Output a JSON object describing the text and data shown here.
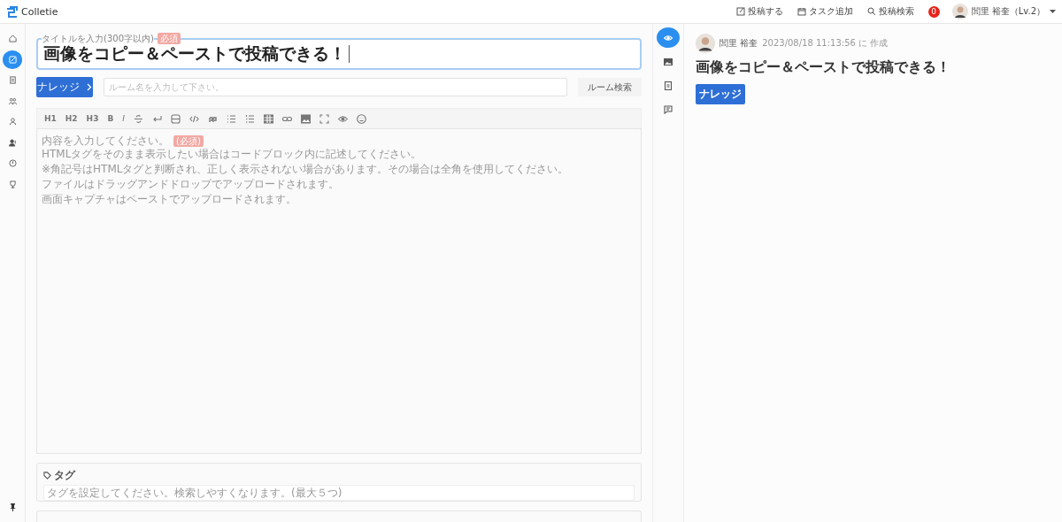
{
  "header": {
    "logo": "Colletie",
    "actions": [
      "投稿する",
      "タスク追加",
      "投稿検索"
    ],
    "notification_count": "0",
    "user_name": "閭里 裕奎（Lv.2）"
  },
  "sidebar": {
    "items": [
      {
        "selected": false
      },
      {
        "selected": true
      },
      {
        "selected": false
      },
      {
        "selected": false
      },
      {
        "selected": false
      },
      {
        "selected": false
      },
      {
        "selected": false
      },
      {
        "selected": false
      }
    ]
  },
  "editor": {
    "title_label": "タイトルを入力(300字以内)",
    "title_required": "必須",
    "title_value": "画像をコピー＆ペーストで投稿できる！",
    "category_button": "ナレッジ",
    "room_placeholder": "ルーム名を入力して下さい。",
    "room_search_button": "ルーム検索",
    "toolbar_text_buttons": [
      "H1",
      "H2",
      "H3",
      "B",
      "I"
    ],
    "content_placeholder": "内容を入力してください。",
    "content_required": "(必須)",
    "content_hints": [
      "HTMLタグをそのまま表示したい場合はコードブロック内に記述してください。",
      "※角記号はHTMLタグと判断され、正しく表示されない場合があります。その場合は全角を使用してください。",
      "ファイルはドラッグアンドドロップでアップロードされます。",
      "画面キャプチャはペーストでアップロードされます。"
    ],
    "tag_title": "タグ",
    "tag_placeholder": "タグを設定してください。検索しやすくなります。(最大５つ)"
  },
  "view_tools": [
    {
      "selected": true
    },
    {
      "selected": false
    },
    {
      "selected": false
    },
    {
      "selected": false
    }
  ],
  "preview": {
    "author": "閭里 裕奎",
    "created": "2023/08/18 11:13:56 に 作成",
    "title": "画像をコピー＆ペーストで投稿できる！",
    "tag": "ナレッジ"
  }
}
